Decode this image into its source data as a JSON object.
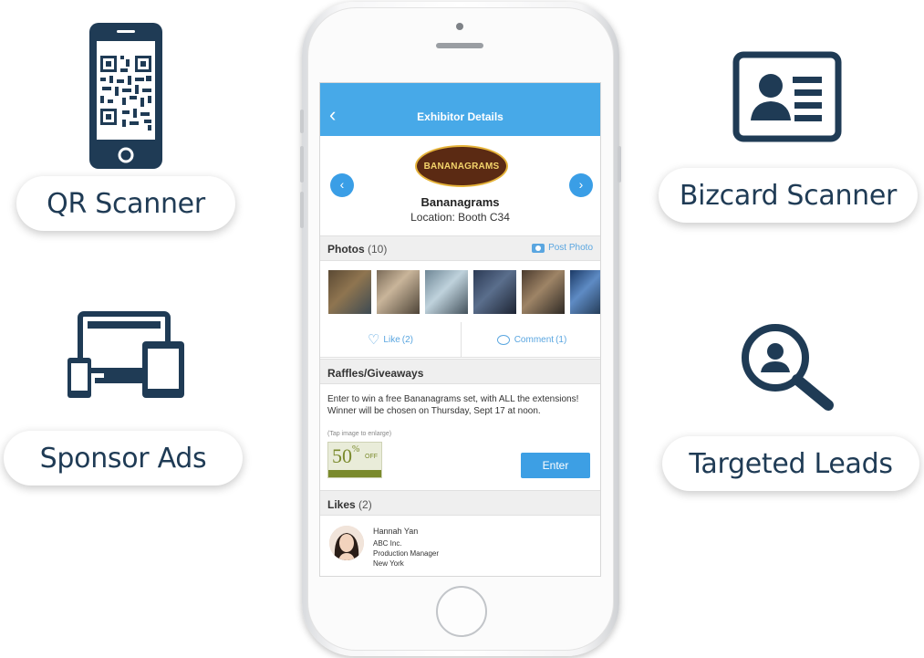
{
  "features": {
    "qr_scanner": {
      "label": "QR Scanner",
      "icon": "qr-phone-icon"
    },
    "sponsor_ads": {
      "label": "Sponsor Ads",
      "icon": "devices-icon"
    },
    "bizcard_scanner": {
      "label": "Bizcard Scanner",
      "icon": "id-card-icon"
    },
    "targeted_leads": {
      "label": "Targeted Leads",
      "icon": "search-person-icon"
    }
  },
  "app": {
    "title": "Exhibitor Details",
    "back_icon": "back-arrow-icon",
    "accent_color": "#47a9e8",
    "exhibitor": {
      "logo_text": "BANANAGRAMS",
      "name": "Bananagrams",
      "location": "Location: Booth C34"
    },
    "photos": {
      "label": "Photos",
      "count": "(10)",
      "post_label": "Post Photo"
    },
    "actions": {
      "like_label": "Like",
      "like_count": "(2)",
      "comment_label": "Comment",
      "comment_count": "(1)"
    },
    "raffles": {
      "title": "Raffles/Giveaways",
      "description": "Enter to win a free Bananagrams set, with ALL the extensions! Winner will be chosen on Thursday, Sept 17 at noon.",
      "note": "(Tap image to enlarge)",
      "coupon_big": "50",
      "coupon_pct": "%",
      "coupon_off": "OFF",
      "enter_label": "Enter"
    },
    "likes": {
      "label": "Likes",
      "count": "(2)",
      "person": {
        "name": "Hannah Yan",
        "company": "ABC Inc.",
        "title": "Production Manager",
        "city": "New York"
      }
    }
  }
}
